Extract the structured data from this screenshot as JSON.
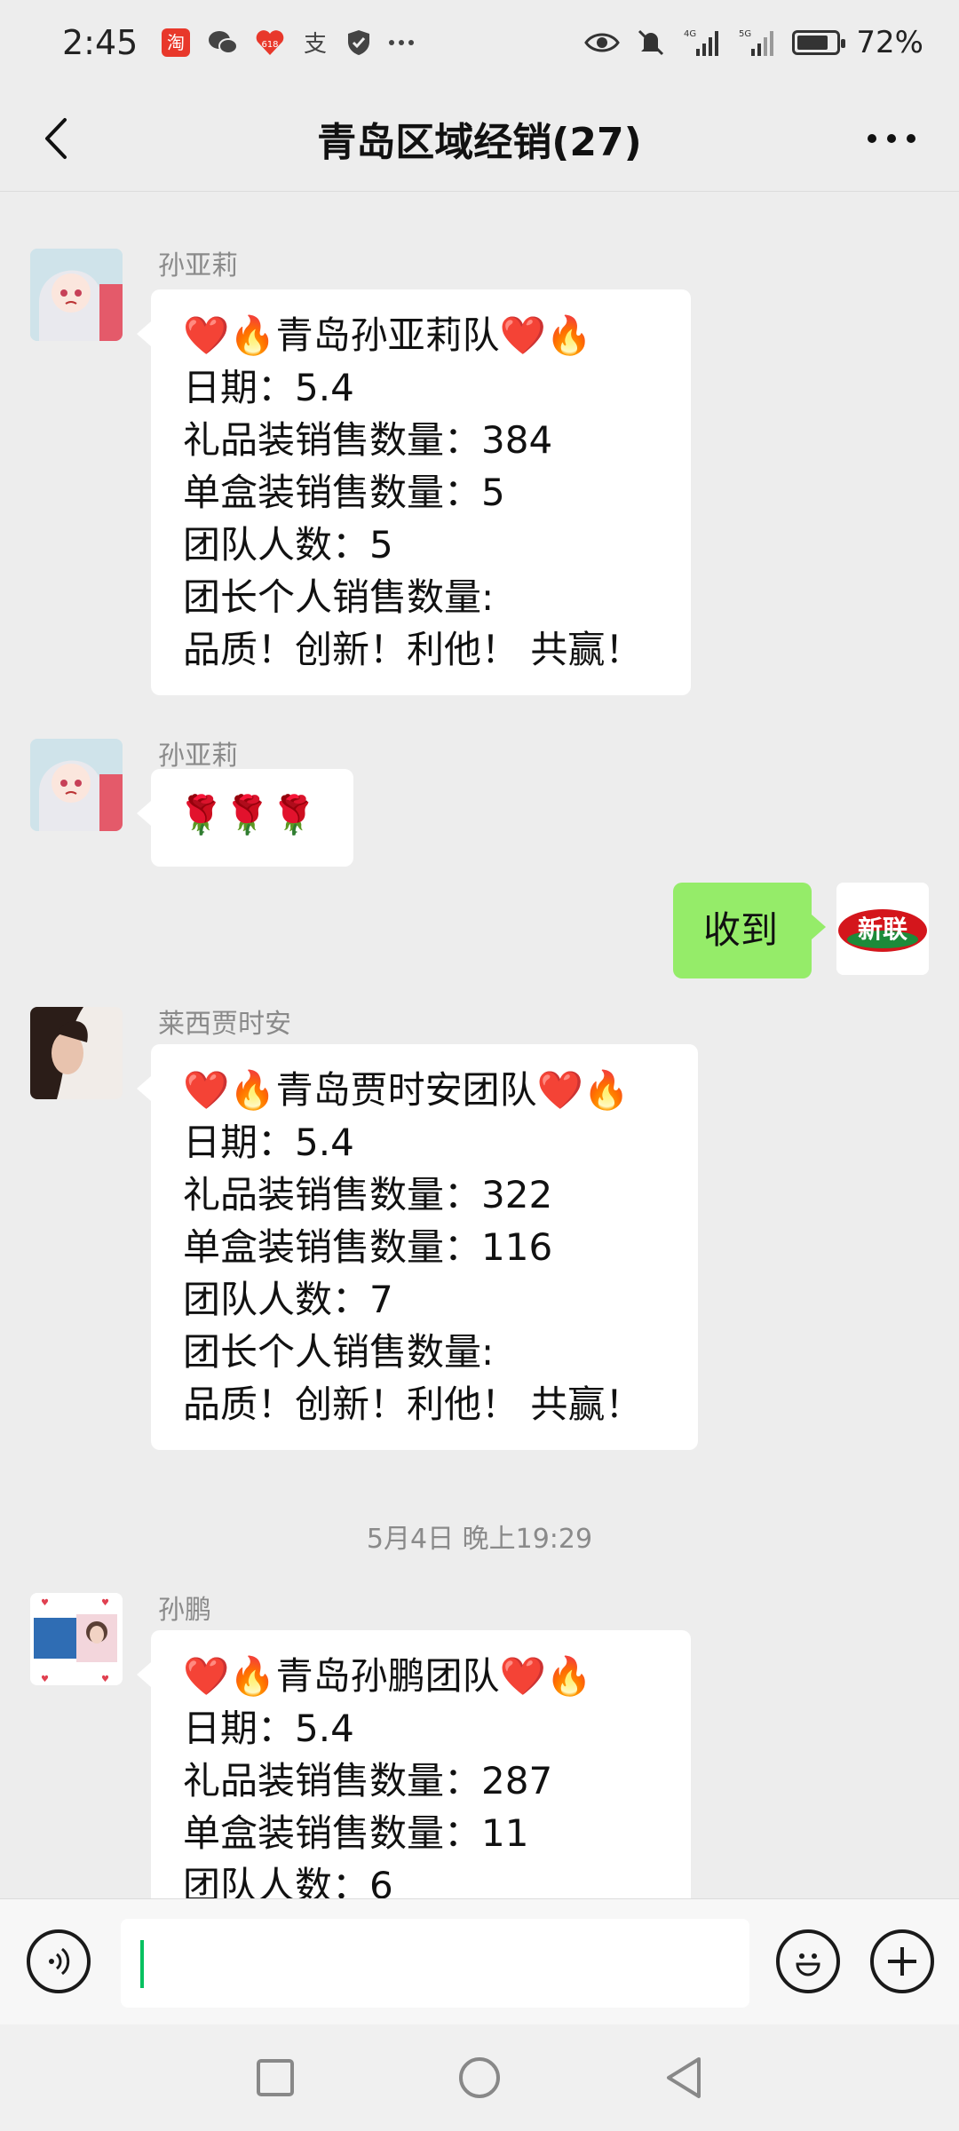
{
  "status_bar": {
    "time": "2:45",
    "battery_percent": "72%",
    "battery_level": 0.72,
    "network_1": "4G",
    "network_2": "5G",
    "left_icons": [
      "taobao-icon",
      "wechat-icon",
      "app-618-icon",
      "alipay-icon",
      "shield-icon",
      "more-dots-icon"
    ],
    "right_icons": [
      "eye-icon",
      "mute-icon",
      "signal-4g-icon",
      "signal-5g-icon",
      "battery-icon"
    ]
  },
  "header": {
    "title": "青岛区域经销(27)",
    "back_icon": "back-arrow-icon",
    "more_icon": "more-icon"
  },
  "messages": [
    {
      "sender": "孙亚莉",
      "lines": [
        "❤️🔥青岛孙亚莉队❤️🔥",
        "日期：5.4",
        "礼品装销售数量：384",
        "单盒装销售数量：5",
        "团队人数：5",
        "团长个人销售数量:",
        "品质！创新！利他！ 共赢！"
      ]
    },
    {
      "sender": "孙亚莉",
      "lines": [
        "🌹🌹🌹"
      ]
    },
    {
      "sender": "me",
      "lines": [
        "收到"
      ],
      "avatar_text": "新联"
    },
    {
      "sender": "莱西贾时安",
      "lines": [
        "❤️🔥青岛贾时安团队❤️🔥",
        "日期：5.4",
        "礼品装销售数量：322",
        "单盒装销售数量：116",
        "团队人数：7",
        "团长个人销售数量:",
        "品质！创新！利他！ 共赢！"
      ]
    },
    {
      "timestamp": "5月4日 晚上19:29"
    },
    {
      "sender": "孙鹏",
      "lines": [
        "❤️🔥青岛孙鹏团队❤️🔥",
        "日期：5.4",
        "礼品装销售数量：287",
        "单盒装销售数量：11",
        "团队人数：6"
      ]
    }
  ],
  "input_bar": {
    "voice_icon": "voice-icon",
    "emoji_icon": "emoji-icon",
    "add_icon": "plus-icon",
    "text": ""
  },
  "nav_bar": {
    "icons": [
      "recent-apps-icon",
      "home-icon",
      "back-icon"
    ]
  },
  "colors": {
    "background": "#ededed",
    "my_bubble": "#95ec69",
    "other_bubble": "#ffffff",
    "caret": "#07c160",
    "avatar_brand_red": "#d4161c"
  }
}
